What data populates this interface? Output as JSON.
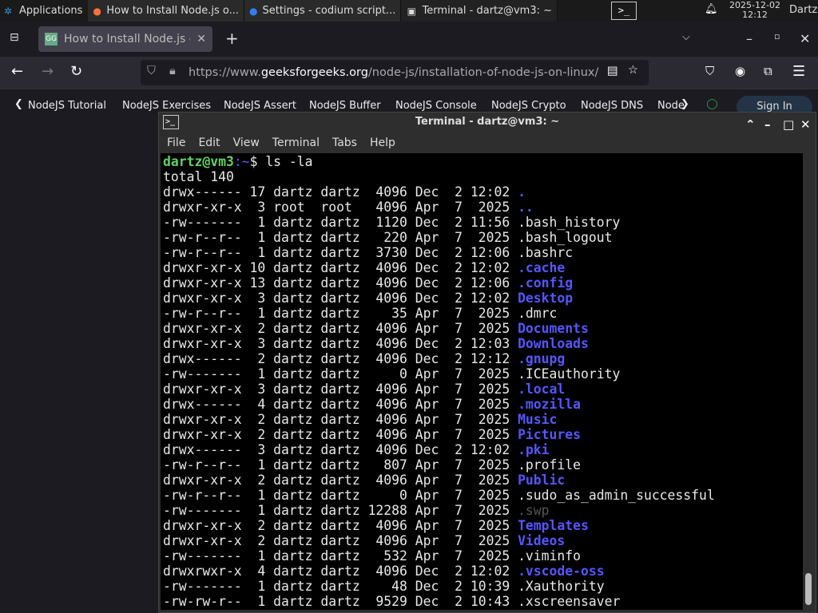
{
  "taskbar": {
    "apps_label": "Applications",
    "tasks": [
      {
        "label": "How to Install Node.js o...",
        "icon": "firefox-icon"
      },
      {
        "label": "Settings - codium script...",
        "icon": "codium-icon"
      },
      {
        "label": "Terminal - dartz@vm3: ~",
        "icon": "terminal-icon"
      }
    ],
    "date": "2025-12-02",
    "time": "12:12",
    "user": "Dartz"
  },
  "browser": {
    "tab_title": "How to Install Node.js on",
    "url_prefix": "https://www.",
    "url_domain": "geeksforgeeks.org",
    "url_path": "/node-js/installation-of-node-js-on-linux/",
    "bookmarks": [
      "NodeJS Tutorial",
      "NodeJS Exercises",
      "NodeJS Assert",
      "NodeJS Buffer",
      "NodeJS Console",
      "NodeJS Crypto",
      "NodeJS DNS",
      "Node"
    ],
    "sign_in": "Sign In"
  },
  "terminal": {
    "title": "Terminal - dartz@vm3: ~",
    "menu": [
      "File",
      "Edit",
      "View",
      "Terminal",
      "Tabs",
      "Help"
    ],
    "prompt_user": "dartz@vm3",
    "prompt_path": ":~",
    "prompt_symbol": "$ ",
    "command": "ls -la",
    "total": "total 140",
    "entries": [
      {
        "info": "drwx------ 17 dartz dartz  4096 Dec  2 12:02 ",
        "name": ".",
        "type": "dir"
      },
      {
        "info": "drwxr-xr-x  3 root  root   4096 Apr  7  2025 ",
        "name": "..",
        "type": "dir"
      },
      {
        "info": "-rw-------  1 dartz dartz  1120 Dec  2 11:56 ",
        "name": ".bash_history",
        "type": "file"
      },
      {
        "info": "-rw-r--r--  1 dartz dartz   220 Apr  7  2025 ",
        "name": ".bash_logout",
        "type": "file"
      },
      {
        "info": "-rw-r--r--  1 dartz dartz  3730 Dec  2 12:06 ",
        "name": ".bashrc",
        "type": "file"
      },
      {
        "info": "drwxr-xr-x 10 dartz dartz  4096 Dec  2 12:02 ",
        "name": ".cache",
        "type": "dir"
      },
      {
        "info": "drwxr-xr-x 13 dartz dartz  4096 Dec  2 12:06 ",
        "name": ".config",
        "type": "dir"
      },
      {
        "info": "drwxr-xr-x  3 dartz dartz  4096 Dec  2 12:02 ",
        "name": "Desktop",
        "type": "dir"
      },
      {
        "info": "-rw-r--r--  1 dartz dartz    35 Apr  7  2025 ",
        "name": ".dmrc",
        "type": "file"
      },
      {
        "info": "drwxr-xr-x  2 dartz dartz  4096 Apr  7  2025 ",
        "name": "Documents",
        "type": "dir"
      },
      {
        "info": "drwxr-xr-x  3 dartz dartz  4096 Dec  2 12:03 ",
        "name": "Downloads",
        "type": "dir"
      },
      {
        "info": "drwx------  2 dartz dartz  4096 Dec  2 12:12 ",
        "name": ".gnupg",
        "type": "dir"
      },
      {
        "info": "-rw-------  1 dartz dartz     0 Apr  7  2025 ",
        "name": ".ICEauthority",
        "type": "file"
      },
      {
        "info": "drwxr-xr-x  3 dartz dartz  4096 Apr  7  2025 ",
        "name": ".local",
        "type": "dir"
      },
      {
        "info": "drwx------  4 dartz dartz  4096 Apr  7  2025 ",
        "name": ".mozilla",
        "type": "dir"
      },
      {
        "info": "drwxr-xr-x  2 dartz dartz  4096 Apr  7  2025 ",
        "name": "Music",
        "type": "dir"
      },
      {
        "info": "drwxr-xr-x  2 dartz dartz  4096 Apr  7  2025 ",
        "name": "Pictures",
        "type": "dir"
      },
      {
        "info": "drwx------  3 dartz dartz  4096 Dec  2 12:02 ",
        "name": ".pki",
        "type": "dir"
      },
      {
        "info": "-rw-r--r--  1 dartz dartz   807 Apr  7  2025 ",
        "name": ".profile",
        "type": "file"
      },
      {
        "info": "drwxr-xr-x  2 dartz dartz  4096 Apr  7  2025 ",
        "name": "Public",
        "type": "dir"
      },
      {
        "info": "-rw-r--r--  1 dartz dartz     0 Apr  7  2025 ",
        "name": ".sudo_as_admin_successful",
        "type": "file"
      },
      {
        "info": "-rw-------  1 dartz dartz 12288 Apr  7  2025 ",
        "name": ".swp",
        "type": "dim"
      },
      {
        "info": "drwxr-xr-x  2 dartz dartz  4096 Apr  7  2025 ",
        "name": "Templates",
        "type": "dir"
      },
      {
        "info": "drwxr-xr-x  2 dartz dartz  4096 Apr  7  2025 ",
        "name": "Videos",
        "type": "dir"
      },
      {
        "info": "-rw-------  1 dartz dartz   532 Apr  7  2025 ",
        "name": ".viminfo",
        "type": "file"
      },
      {
        "info": "drwxrwxr-x  4 dartz dartz  4096 Dec  2 12:02 ",
        "name": ".vscode-oss",
        "type": "dir"
      },
      {
        "info": "-rw-------  1 dartz dartz    48 Dec  2 10:39 ",
        "name": ".Xauthority",
        "type": "file"
      },
      {
        "info": "-rw-rw-r--  1 dartz dartz  9529 Dec  2 10:43 ",
        "name": ".xscreensaver",
        "type": "file"
      }
    ]
  },
  "colors": {
    "prompt": "#5fd35f",
    "directory": "#5555ff",
    "terminal_bg": "#000000"
  }
}
